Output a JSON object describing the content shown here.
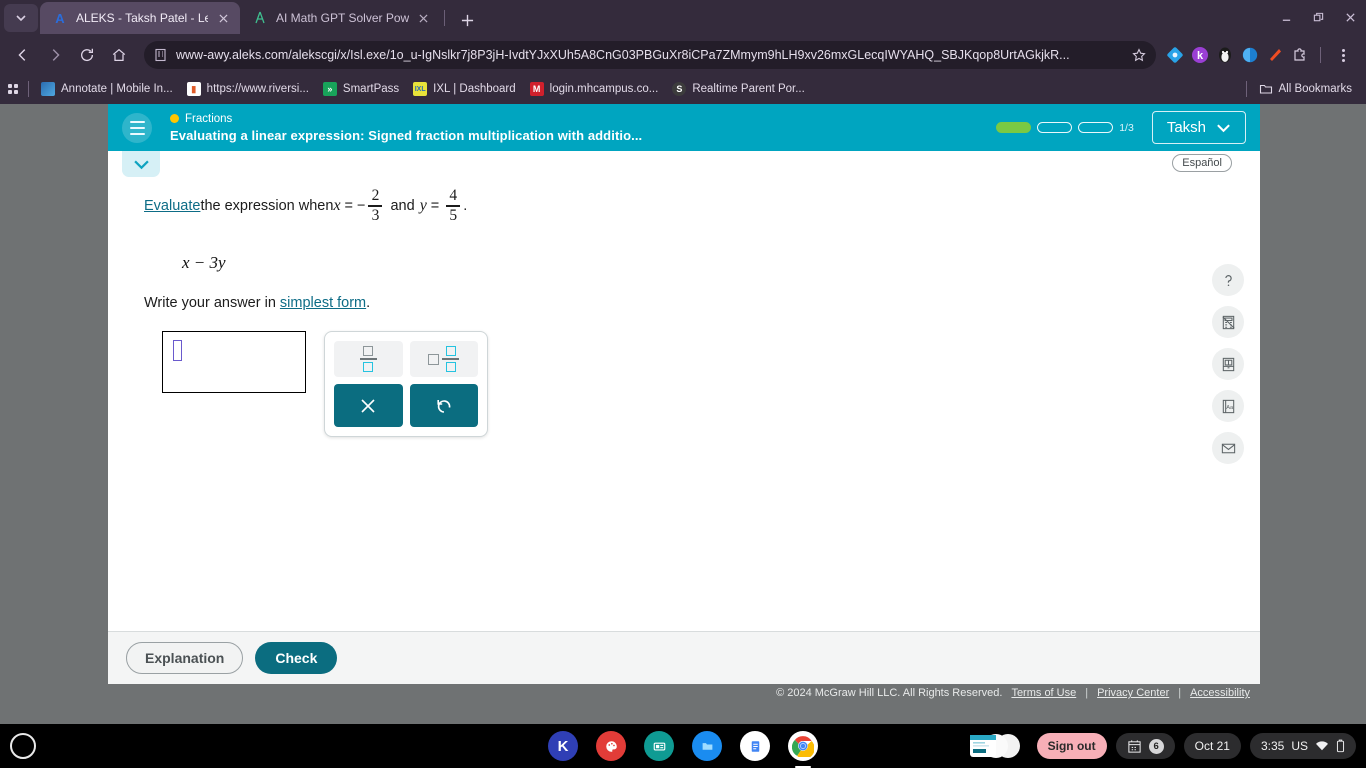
{
  "browser": {
    "tabs": [
      {
        "title": "ALEKS - Taksh Patel - Learn",
        "favicon": "A",
        "active": true
      },
      {
        "title": "AI Math GPT Solver Powered b",
        "favicon": "compass-icon",
        "active": false
      }
    ],
    "new_tab_label": "+",
    "url": "www-awy.aleks.com/alekscgi/x/Isl.exe/1o_u-IgNslkr7j8P3jH-IvdtYJxXUh5A8CnG03PBGuXr8iCPa7ZMmym9hLH9xv26mxGLecqIWYAHQ_SBJKqop8UrtAGkjkR...",
    "bookmarks": [
      {
        "label": "Annotate | Mobile In...",
        "icon": "annotate-icon",
        "color": "#2b6cb0"
      },
      {
        "label": "https://www.riversi...",
        "icon": "chart-icon",
        "color": "#e05c2a"
      },
      {
        "label": "SmartPass",
        "icon": "smartpass-icon",
        "color": "#18a35a"
      },
      {
        "label": "IXL | Dashboard",
        "icon": "ixl-icon",
        "color": "#e8e33a"
      },
      {
        "label": "login.mhcampus.co...",
        "icon": "mcgraw-icon",
        "color": "#d0202c"
      },
      {
        "label": "Realtime Parent Por...",
        "icon": "realtime-icon",
        "color": "#3c3c3c"
      }
    ],
    "all_bookmarks_label": "All Bookmarks"
  },
  "aleks": {
    "topic": "Fractions",
    "objective": "Evaluating a linear expression: Signed fraction multiplication with additio...",
    "progress": {
      "segments": 3,
      "filled": 1,
      "label": "1/3"
    },
    "user": "Taksh",
    "espanol_label": "Español",
    "question": {
      "prefix_link": "Evaluate",
      "text_1": " the expression when ",
      "var_x": "x",
      "eq": "=",
      "minus": "−",
      "x_num": "2",
      "x_den": "3",
      "and": "and",
      "var_y": "y",
      "y_num": "4",
      "y_den": "5",
      "period": ".",
      "expression": "x − 3y",
      "instruction_prefix": "Write your answer in ",
      "instruction_link": "simplest form",
      "instruction_suffix": "."
    },
    "answer_value": "",
    "keypad": {
      "fraction_label": "fraction-button",
      "mixed_label": "mixed-number-button",
      "clear_label": "×",
      "undo_label": "↺"
    },
    "rail": [
      {
        "name": "help-icon",
        "glyph": "?"
      },
      {
        "name": "calculator-icon",
        "glyph": ""
      },
      {
        "name": "reference-book-icon",
        "glyph": ""
      },
      {
        "name": "dictionary-icon",
        "glyph": "Aa"
      },
      {
        "name": "mail-icon",
        "glyph": ""
      }
    ],
    "explanation_label": "Explanation",
    "check_label": "Check",
    "footer": {
      "copyright": "© 2024 McGraw Hill LLC. All Rights Reserved.",
      "terms": "Terms of Use",
      "privacy": "Privacy Center",
      "accessibility": "Accessibility",
      "sep": "|"
    },
    "accent_color": "#00a5c0",
    "button_color": "#0b6d80"
  },
  "shelf": {
    "apps": [
      {
        "name": "kami-app",
        "label": "K",
        "color": "#2f3fb5"
      },
      {
        "name": "paint-app",
        "label": "",
        "color": "#e23c38"
      },
      {
        "name": "screencast-app",
        "label": "",
        "color": "#0f9b93"
      },
      {
        "name": "files-app",
        "label": "",
        "color": "#1a8cf0"
      },
      {
        "name": "docs-app",
        "label": "",
        "color": "#ffffff"
      },
      {
        "name": "chrome-app",
        "label": "",
        "color": "#f4b400"
      }
    ],
    "sign_out_label": "Sign out",
    "calendar_count": "6",
    "date": "Oct 21",
    "time": "3:35",
    "locale": "US"
  }
}
